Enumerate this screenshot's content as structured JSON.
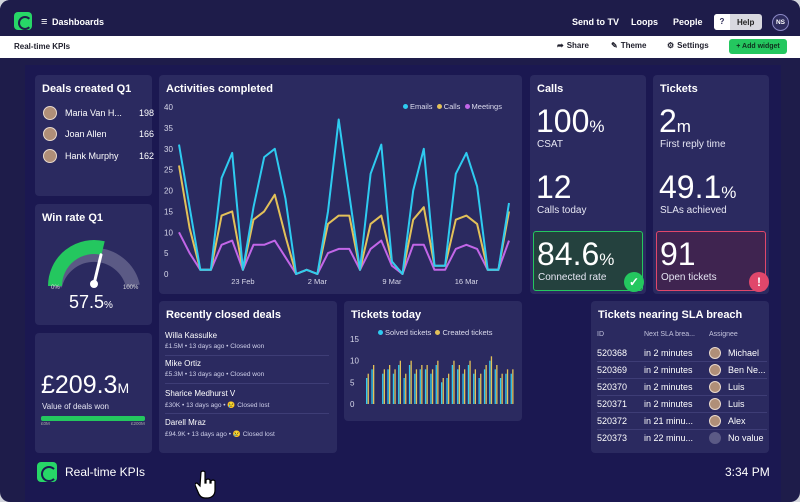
{
  "nav": {
    "dashboards_label": "Dashboards",
    "links": [
      "Send to TV",
      "Loops",
      "People"
    ],
    "help_label": "Help",
    "help_glyph": "?",
    "avatar_initials": "NS"
  },
  "toolbar": {
    "title": "Real-time KPIs",
    "share_label": "Share",
    "theme_label": "Theme",
    "settings_label": "Settings",
    "add_widget_label": "+ Add widget"
  },
  "deals_created": {
    "title": "Deals created Q1",
    "rows": [
      {
        "name": "Maria Van H...",
        "value": "198"
      },
      {
        "name": "Joan Allen",
        "value": "166"
      },
      {
        "name": "Hank Murphy",
        "value": "162"
      }
    ]
  },
  "win_rate": {
    "title": "Win rate Q1",
    "min_label": "0%",
    "max_label": "100%",
    "value_text": "57.5",
    "unit": "%",
    "fraction": 0.575
  },
  "deals_value": {
    "amount": "£209.3",
    "suffix": "M",
    "label": "Value of deals won",
    "bar_min": "£0M",
    "bar_max": "£200M",
    "fill_fraction": 1.0
  },
  "activities": {
    "title": "Activities completed",
    "chart_data": {
      "type": "line",
      "title": "Activities completed",
      "x": [
        "17 Feb",
        "18 Feb",
        "19 Feb",
        "20 Feb",
        "21 Feb",
        "22 Feb",
        "23 Feb",
        "24 Feb",
        "25 Feb",
        "26 Feb",
        "27 Feb",
        "28 Feb",
        "1 Mar",
        "2 Mar",
        "3 Mar",
        "4 Mar",
        "5 Mar",
        "6 Mar",
        "7 Mar",
        "8 Mar",
        "9 Mar",
        "10 Mar",
        "11 Mar",
        "12 Mar",
        "13 Mar",
        "14 Mar",
        "15 Mar",
        "16 Mar",
        "17 Mar",
        "18 Mar",
        "19 Mar",
        "20 Mar"
      ],
      "xticks": [
        "23 Feb",
        "2 Mar",
        "9 Mar",
        "16 Mar"
      ],
      "ylim": [
        0,
        40
      ],
      "yticks": [
        0,
        5,
        10,
        15,
        20,
        25,
        30,
        35,
        40
      ],
      "legend_position": "top-right",
      "series": [
        {
          "name": "Emails",
          "color": "#2ecbf0",
          "values": [
            31,
            16,
            1,
            1,
            23,
            29,
            1,
            16,
            28,
            30,
            18,
            0,
            1,
            0,
            15,
            37,
            19,
            1,
            24,
            31,
            3,
            0,
            20,
            30,
            2,
            2,
            24,
            29,
            21,
            1,
            1,
            17
          ]
        },
        {
          "name": "Calls",
          "color": "#e3c159",
          "values": [
            26,
            11,
            1,
            1,
            14,
            15,
            1,
            13,
            15,
            19,
            9,
            0,
            1,
            0,
            12,
            14,
            14,
            1,
            12,
            14,
            3,
            0,
            13,
            16,
            2,
            2,
            13,
            14,
            12,
            1,
            1,
            15
          ]
        },
        {
          "name": "Meetings",
          "color": "#c266e8",
          "values": [
            10,
            5,
            1,
            1,
            7,
            8,
            1,
            7,
            7,
            8,
            4,
            0,
            1,
            0,
            5,
            6,
            6,
            1,
            6,
            8,
            2,
            0,
            7,
            7,
            1,
            1,
            6,
            7,
            6,
            1,
            1,
            8
          ]
        }
      ]
    }
  },
  "calls": {
    "title": "Calls",
    "csat_value": "100",
    "csat_unit": "%",
    "csat_label": "CSAT",
    "today_value": "12",
    "today_label": "Calls today",
    "connected_value": "84.6",
    "connected_unit": "%",
    "connected_label": "Connected rate",
    "status_glyph": "✓"
  },
  "tickets": {
    "title": "Tickets",
    "reply_value": "2",
    "reply_unit": "m",
    "reply_label": "First reply time",
    "sla_value": "49.1",
    "sla_unit": "%",
    "sla_label": "SLAs achieved",
    "open_value": "91",
    "open_label": "Open tickets",
    "status_glyph": "!"
  },
  "closed_deals": {
    "title": "Recently closed deals",
    "rows": [
      {
        "name": "Willa Kassulke",
        "meta": "£1.5M • 13 days ago • Closed won"
      },
      {
        "name": "Mike Ortiz",
        "meta": "£5.3M • 13 days ago • Closed won"
      },
      {
        "name": "Sharice Medhurst V",
        "meta": "£30K • 13 days ago • 😢 Closed lost"
      },
      {
        "name": "Darell Mraz",
        "meta": "£94.9K • 13 days ago • 😢 Closed lost"
      }
    ]
  },
  "tickets_today": {
    "title": "Tickets today",
    "chart_data": {
      "type": "bar",
      "title": "Tickets today",
      "ylim": [
        0,
        15
      ],
      "yticks": [
        0,
        5,
        10,
        15
      ],
      "legend_position": "top",
      "series": [
        {
          "name": "Solved tickets",
          "color": "#2ecbf0",
          "values": [
            6,
            8,
            0,
            7,
            8,
            7,
            9,
            6,
            9,
            7,
            8,
            8,
            7,
            9,
            5,
            6,
            9,
            8,
            7,
            9,
            7,
            6,
            8,
            10,
            8,
            6,
            7,
            7
          ]
        },
        {
          "name": "Created tickets",
          "color": "#e3c159",
          "values": [
            7,
            9,
            0,
            8,
            9,
            8,
            10,
            7,
            10,
            8,
            9,
            9,
            8,
            10,
            6,
            7,
            10,
            9,
            8,
            10,
            8,
            7,
            9,
            11,
            9,
            7,
            8,
            8
          ]
        }
      ]
    }
  },
  "sla_breach": {
    "title": "Tickets nearing SLA breach",
    "columns": [
      "ID",
      "Next SLA brea...",
      "Assignee"
    ],
    "rows": [
      {
        "id": "520368",
        "time": "in 2 minutes",
        "assignee": "Michael",
        "avatar": true
      },
      {
        "id": "520369",
        "time": "in 2 minutes",
        "assignee": "Ben Ne...",
        "avatar": true
      },
      {
        "id": "520370",
        "time": "in 2 minutes",
        "assignee": "Luis",
        "avatar": true
      },
      {
        "id": "520371",
        "time": "in 2 minutes",
        "assignee": "Luis",
        "avatar": true
      },
      {
        "id": "520372",
        "time": "in 21 minu...",
        "assignee": "Alex",
        "avatar": true
      },
      {
        "id": "520373",
        "time": "in 22 minu...",
        "assignee": "No value",
        "avatar": false
      }
    ]
  },
  "footer": {
    "title": "Real-time KPIs",
    "time": "3:34 PM"
  },
  "colors": {
    "accent_green": "#24c75f",
    "alert_red": "#e0476b",
    "panel": "#2b2a60",
    "background": "#1b1851"
  }
}
